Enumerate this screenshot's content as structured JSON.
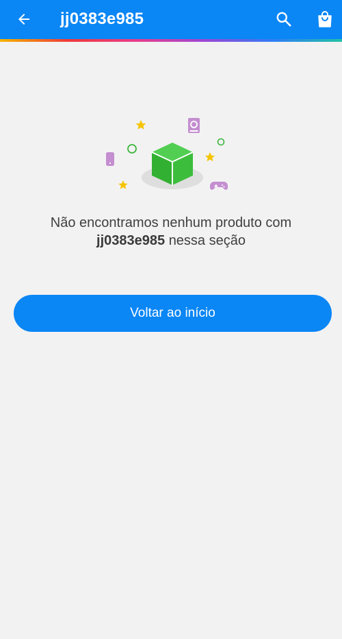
{
  "header": {
    "title": "jj0383e985",
    "back_icon": "arrow-left-icon",
    "search_icon": "search-icon",
    "cart_icon": "shopping-bag-icon",
    "bar_color": "#0a86f5"
  },
  "empty_state": {
    "illustration": "green-box-with-stars-icon",
    "message_prefix": "Não encontramos nenhum produto com",
    "search_term": "jj0383e985",
    "message_suffix": "nessa seção"
  },
  "actions": {
    "home_label": "Voltar ao início",
    "button_color": "#0a86f5"
  }
}
